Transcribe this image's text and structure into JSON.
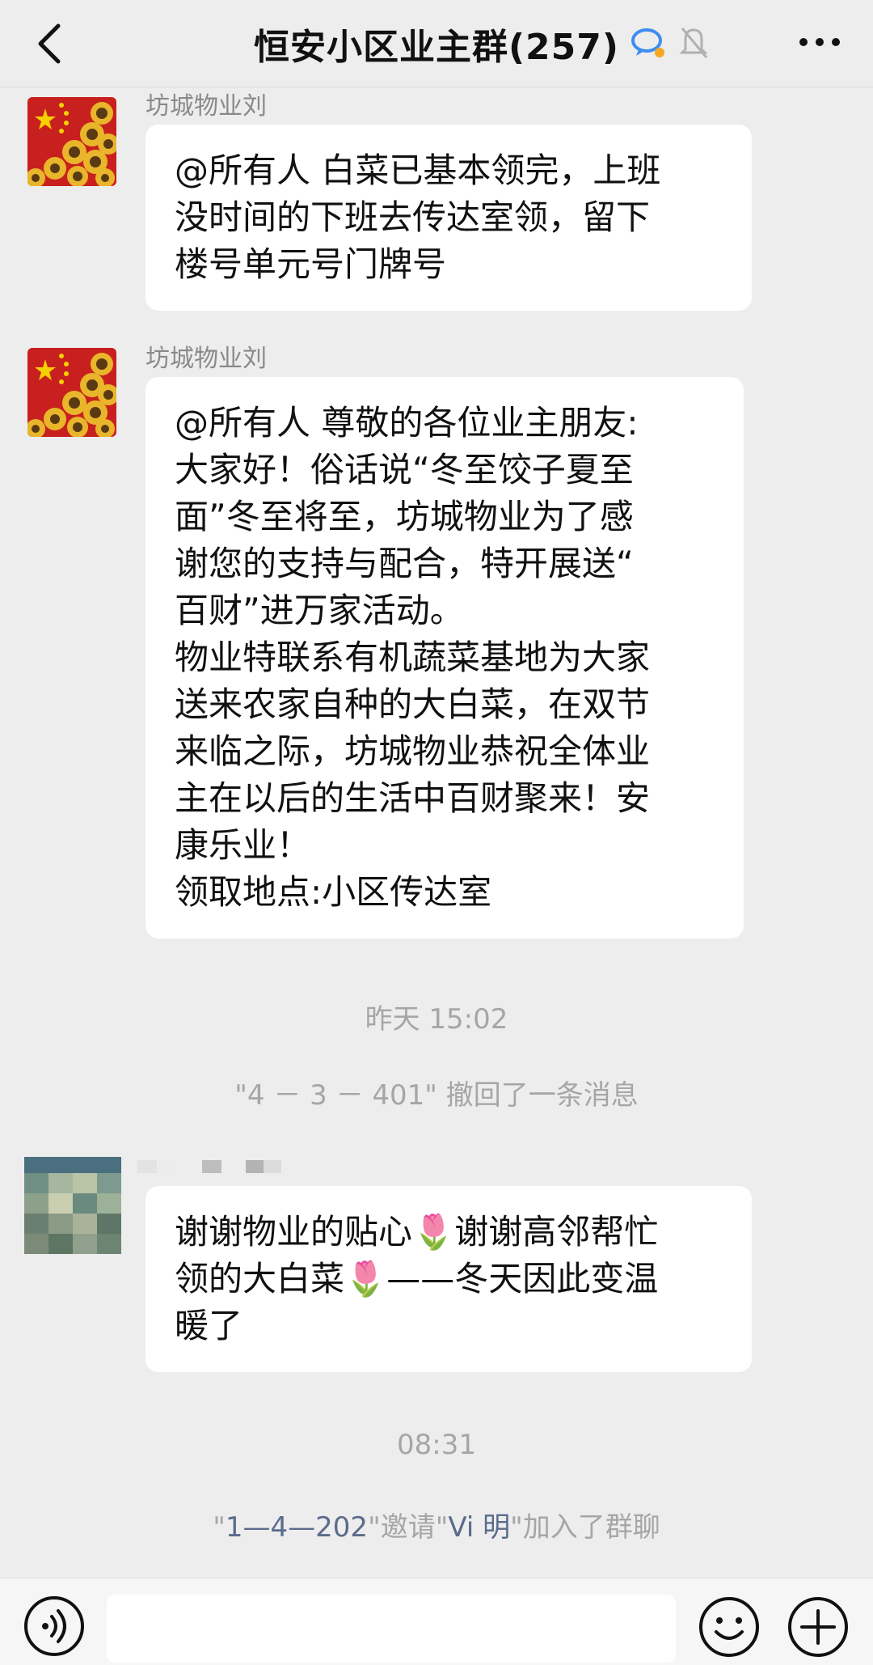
{
  "header": {
    "title": "恒安小区业主群(257)",
    "back_icon": "chevron-left-icon",
    "more_icon": "more-dots-icon"
  },
  "messages": [
    {
      "sender": "坊城物业刘",
      "text": "@所有人 白菜已基本领完，上班\n没时间的下班去传达室领，留下\n楼号单元号门牌号"
    },
    {
      "sender": "坊城物业刘",
      "text": "@所有人 尊敬的各位业主朋友:\n大家好！俗话说“冬至饺子夏至\n面”冬至将至，坊城物业为了感\n谢您的支持与配合，特开展送“\n百财”进万家活动。\n物业特联系有机蔬菜基地为大家\n送来农家自种的大白菜，在双节\n来临之际，坊城物业恭祝全体业\n主在以后的生活中百财聚来！安\n康乐业！\n领取地点:小区传达室"
    },
    {
      "text": "谢谢物业的贴心🌷谢谢高邻帮忙\n领的大白菜🌷——冬天因此变温\n暖了"
    }
  ],
  "system": {
    "time1": "昨天 15:02",
    "recall_notice": "\"4 － 3 － 401\" 撤回了一条消息",
    "time2": "08:31",
    "invite_q1": "\"",
    "invite_from": "1—4—202",
    "invite_q2": "\"邀请\"",
    "invite_to": "Vi 明",
    "invite_q3": "\"加入了群聊"
  },
  "colors": {
    "background": "#ededed",
    "bubble": "#ffffff",
    "system_text": "#a6a6a6",
    "link_text": "#5a6b8c"
  }
}
